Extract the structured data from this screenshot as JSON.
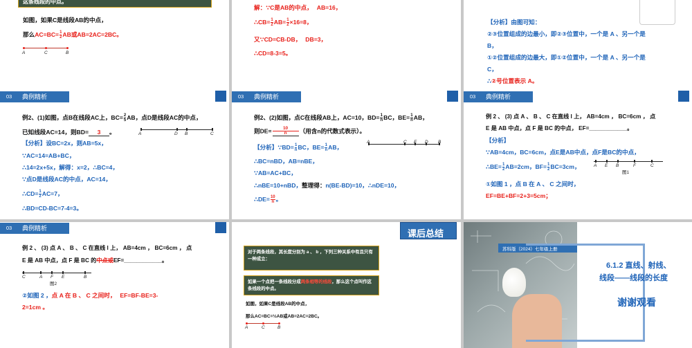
{
  "panels": {
    "p1": {
      "top_box": "这条线段的中点。",
      "line1": "如图，如果C是线段AB的中点，",
      "line2_a": "那么",
      "line2_b": "AC=BC=",
      "line2_frac_n": "1",
      "line2_frac_d": "2",
      "line2_c": "AB或AB=2AC=2BC。",
      "pts": [
        "A",
        "C",
        "B"
      ]
    },
    "p2": {
      "l1_a": "解：∵",
      "l1_b": "C是AB的中点，",
      "l1_c": "AB=16，",
      "l2_a": "∴CB=",
      "l2_n": "1",
      "l2_d": "2",
      "l2_b": "AB=",
      "l2_n2": "1",
      "l2_d2": "2",
      "l2_c": "×16=8，",
      "l3_a": "又∵",
      "l3_b": "CD=CB-DB，",
      "l3_c": "DB=3，",
      "l4": "∴CD=8-3=5。"
    },
    "p3": {
      "l1": "【分析】由图可知：",
      "l2": "②③位置组成的边最小，即②③位置中，一个是 A 、另一个是",
      "l3": "B，",
      "l4": "①②位置组成的边最大，即①②位置中，一个是 A 、另一个是",
      "l5": "C，",
      "l6_a": "∴",
      "l6_b": "②号位置表示 A。"
    },
    "p4": {
      "num": "03",
      "title": "典例精析",
      "l1_a": "例2、(1)如图，点B在线段AC上，BC=",
      "l1_n": "2",
      "l1_d": "5",
      "l1_b": "AB，点D是线段AC的中点，",
      "l2_a": "已知线段AC=14，则BD=",
      "l2_ans": "3",
      "l2_b": "。",
      "pts": [
        "A",
        "D",
        "B",
        "C"
      ],
      "s1_a": "【分析】",
      "s1_b": "设BC=2x，则AB=5x，",
      "s2": "∵AC=14=AB+BC，",
      "s3_a": "∴14=2x+5x，",
      "s3_b": "解得：",
      "s3_c": "x=2，∴BC=4，",
      "s4": "∵点D是线段AC的中点，AC=14，",
      "s5_a": "∴CD=",
      "s5_n": "1",
      "s5_d": "2",
      "s5_b": "AC=7，",
      "s6": "∴BD=CD-BC=7-4=3。"
    },
    "p5": {
      "num": "03",
      "title": "典例精析",
      "l1_a": "例2、(2)如图，点C在线段AB上，AC=10，BD=",
      "l1_n": "1",
      "l1_d": "n",
      "l1_b": "BC，BE=",
      "l1_n2": "1",
      "l1_d2": "n",
      "l1_c": "AB，",
      "l2_a": "则DE=",
      "l2_n": "10",
      "l2_d": "n",
      "l2_b": "（用含n的代数式表示）。",
      "pts": [
        "A",
        "C",
        "E",
        "D",
        "B"
      ],
      "s1_a": "【分析】∵BD=",
      "s1_n": "1",
      "s1_d": "n",
      "s1_b": "BC，BE=",
      "s1_n2": "1",
      "s1_d2": "n",
      "s1_c": "AB，",
      "s2": "∴BC=nBD，AB=nBE，",
      "s3": "∵AB=AC+BC，",
      "s4_a": "∴nBE=10+nBD，",
      "s4_b": "整理得：",
      "s4_c": "n(BE-BD)=10，∴nDE=10，",
      "s5_a": "∴DE=",
      "s5_n": "10",
      "s5_d": "n",
      "s5_b": "。"
    },
    "p6": {
      "num": "03",
      "title": "典例精析",
      "l1": "例 2 、 (3) 点 A 、 B 、 C 在直线 l 上， AB=4cm ， BC=6cm ， 点",
      "l2": "E 是 AB 中点，点 F 是 BC 的中点， EF=____________。",
      "s1": "【分析】",
      "s2_a": "∵AB=4cm，BC=6cm，",
      "s2_b": "点E是AB中点，点F是BC的中点，",
      "s3_a": "∴BE=",
      "s3_n": "1",
      "s3_d": "2",
      "s3_b": "AB=2cm，BF=",
      "s3_n2": "1",
      "s3_d2": "2",
      "s3_c": "BC=3cm，",
      "pts": [
        "A",
        "E",
        "B",
        "F",
        "C"
      ],
      "fig": "图1",
      "s4_a": "①如图 1 ，点 B 在 A 、 C 之间时，",
      "s5": "EF=BE+BF=2+3=5cm；"
    },
    "p7": {
      "num": "03",
      "title": "典例精析",
      "l1": "例 2 、 (3) 点 A 、 B 、 C 在直线 l 上， AB=4cm ， BC=6cm ， 点",
      "l2_a": "E 是 AB 中点，点 F 是 BC 的",
      "l2_b": "中点或",
      "l2_c": "EF=____________。",
      "pts": [
        "C",
        "A",
        "F",
        "E",
        "B"
      ],
      "fig": "图2",
      "s1_a": "②如图 2 ，",
      "s1_b": "点 A 在 B 、 C 之间时，",
      "s1_c": "EF=BF-BE=3-",
      "s2": "2=1cm 。"
    },
    "p8": {
      "title": "课后总结",
      "box1": "对于两条线段，其长度分别为 a 、 b ，下列三种关系中有且只有一种成立：",
      "box2_a": "如果一个点把一条线段分成",
      "box2_b": "两条相等的线段",
      "box2_c": "，那么这个点叫作这条线段的中点。",
      "l1": "如图，如果C是线段AB的中点，",
      "l2": "那么AC=BC=½AB或AB=2AC=2BC。",
      "pts": [
        "A",
        "C",
        "B"
      ]
    },
    "p9": {
      "badge": "苏科版（2024）七年级上册",
      "title1": "6.1.2  直线、射线、",
      "title2": "线段——线段的长度",
      "thanks": "谢谢观看"
    }
  }
}
